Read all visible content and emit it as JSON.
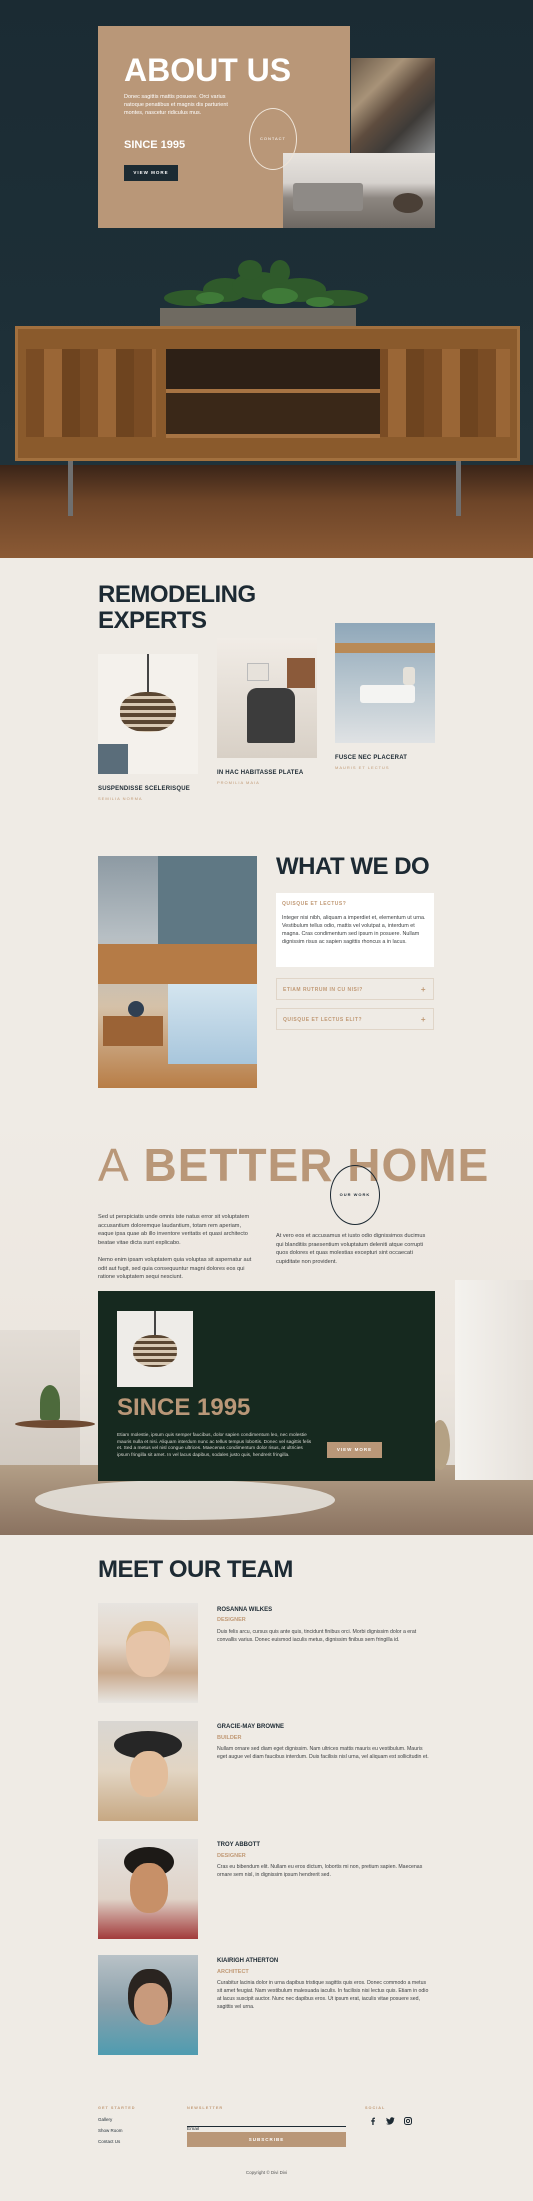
{
  "hero": {
    "title": "ABOUT US",
    "text": "Donec sagittis mattis posuere. Orci varius natoque penatibus et magnis dis parturient montes, nascetur ridiculus mus.",
    "since": "SINCE 1995",
    "button": "VIEW MORE",
    "circle": "CONTACT"
  },
  "remodeling": {
    "title_line1": "REMODELING",
    "title_line2": "EXPERTS",
    "items": [
      {
        "title": "SUSPENDISSE SCELERISQUE",
        "sub": "SEMILIA NORMA"
      },
      {
        "title": "IN HAC HABITASSE PLATEA",
        "sub": "PROMILIA MAIA"
      },
      {
        "title": "FUSCE NEC PLACERAT",
        "sub": "MAURIS ET LECTUS"
      }
    ]
  },
  "whatwedo": {
    "title": "WHAT WE DO",
    "acc1_title": "QUISQUE ET LECTUS?",
    "acc1_text": "Integer nisi nibh, aliquam a imperdiet et, elementum ut urna. Vestibulum tellus odio, mattis vel volutpat a, interdum et magna. Cras condimentum sed ipsum in posuere. Nullam dignissim risus ac sapien sagittis rhoncus a in lacus.",
    "acc2_title": "ETIAM RUTRUM IN CU NISI?",
    "acc3_title": "QUISQUE ET LECTUS ELIT?"
  },
  "better": {
    "title_a": "A",
    "title_rest": "BETTER HOME",
    "circle": "OUR WORK",
    "col1_p1": "Sed ut perspiciatis unde omnis iste natus error sit voluptatem accusantium doloremque laudantium, totam rem aperiam, eaque ipsa quae ab illo inventore veritatis et quasi architecto beatae vitae dicta sunt explicabo.",
    "col1_p2": "Nemo enim ipsam voluptatem quia voluptas sit aspernatur aut odit aut fugit, sed quia consequuntur magni dolores eos qui ratione voluptatem sequi nesciunt.",
    "col2_p1": "At vero eos et accusamus et iusto odio dignissimos ducimus qui blanditiis praesentium voluptatum deleniti atque corrupti quos dolores et quas molestias excepturi sint occaecati cupiditate non provident.",
    "since": "SINCE 1995",
    "dark_text": "Etiam molestie, ipsum quis semper faucibus, dolor sapien condimentum leo, nec molestie mauris nulla et nisi. Aliquam interdum nunc ac tellus tempus lobortis. Donec vel sagittis felis et. Sed a metus vel nisl congue ultrices. Maecenas condimentum dolor risus, at ultricies ipsum fringilla sit amet. In vel lacus dapibus, sodales justo quis, hendrerit fringilla.",
    "button": "VIEW MORE"
  },
  "team": {
    "title": "MEET OUR TEAM",
    "members": [
      {
        "name": "ROSANNA WILKES",
        "role": "DESIGNER",
        "desc": "Duis felis arcu, cursus quis ante quis, tincidunt finibus orci. Morbi dignissim dolor a erat convallis varius. Donec euismod iaculis metus, dignissim finibus sem fringilla id."
      },
      {
        "name": "GRACIE-MAY BROWNE",
        "role": "BUILDER",
        "desc": "Nullam ornare sed diam eget dignissim. Nam ultrices mattis mauris eu vestibulum. Mauris eget augue vel diam faucibus interdum. Duis facilisis nisl urna, vel aliquam est sollicitudin et."
      },
      {
        "name": "TROY ABBOTT",
        "role": "DESIGNER",
        "desc": "Cras eu bibendum elit. Nullam eu eros dictum, lobortis mi non, pretium sapien. Maecenas ornare sem nisl, in dignissim ipsum hendrerit sed."
      },
      {
        "name": "KIAIRIGH ATHERTON",
        "role": "ARCHITECT",
        "desc": "Curabitur lacinia dolor in urna dapibus tristique sagittis quis eros. Donec commodo a metus sit amet feugiat. Nam vestibulum malesuada iaculis. In facilisis nisi lectus quis. Etiam in odio at lacus suscipit auctor. Nunc nec dapibus eros. Ut ipsum erat, iaculis vitae posuere sed, sagittis vel urna."
      }
    ]
  },
  "footer": {
    "col1_head": "GET STARTED",
    "links": [
      "Gallery",
      "Show Room",
      "Contact Us"
    ],
    "col2_head": "NEWSLETTER",
    "email_placeholder": "Email",
    "subscribe": "SUBSCRIBE",
    "col3_head": "SOCIAL",
    "copyright": "Copyright © Divi Divi"
  },
  "colors": {
    "accent": "#b99778",
    "dark": "#1d2a33",
    "green": "#16291f",
    "bg": "#efebe5"
  }
}
